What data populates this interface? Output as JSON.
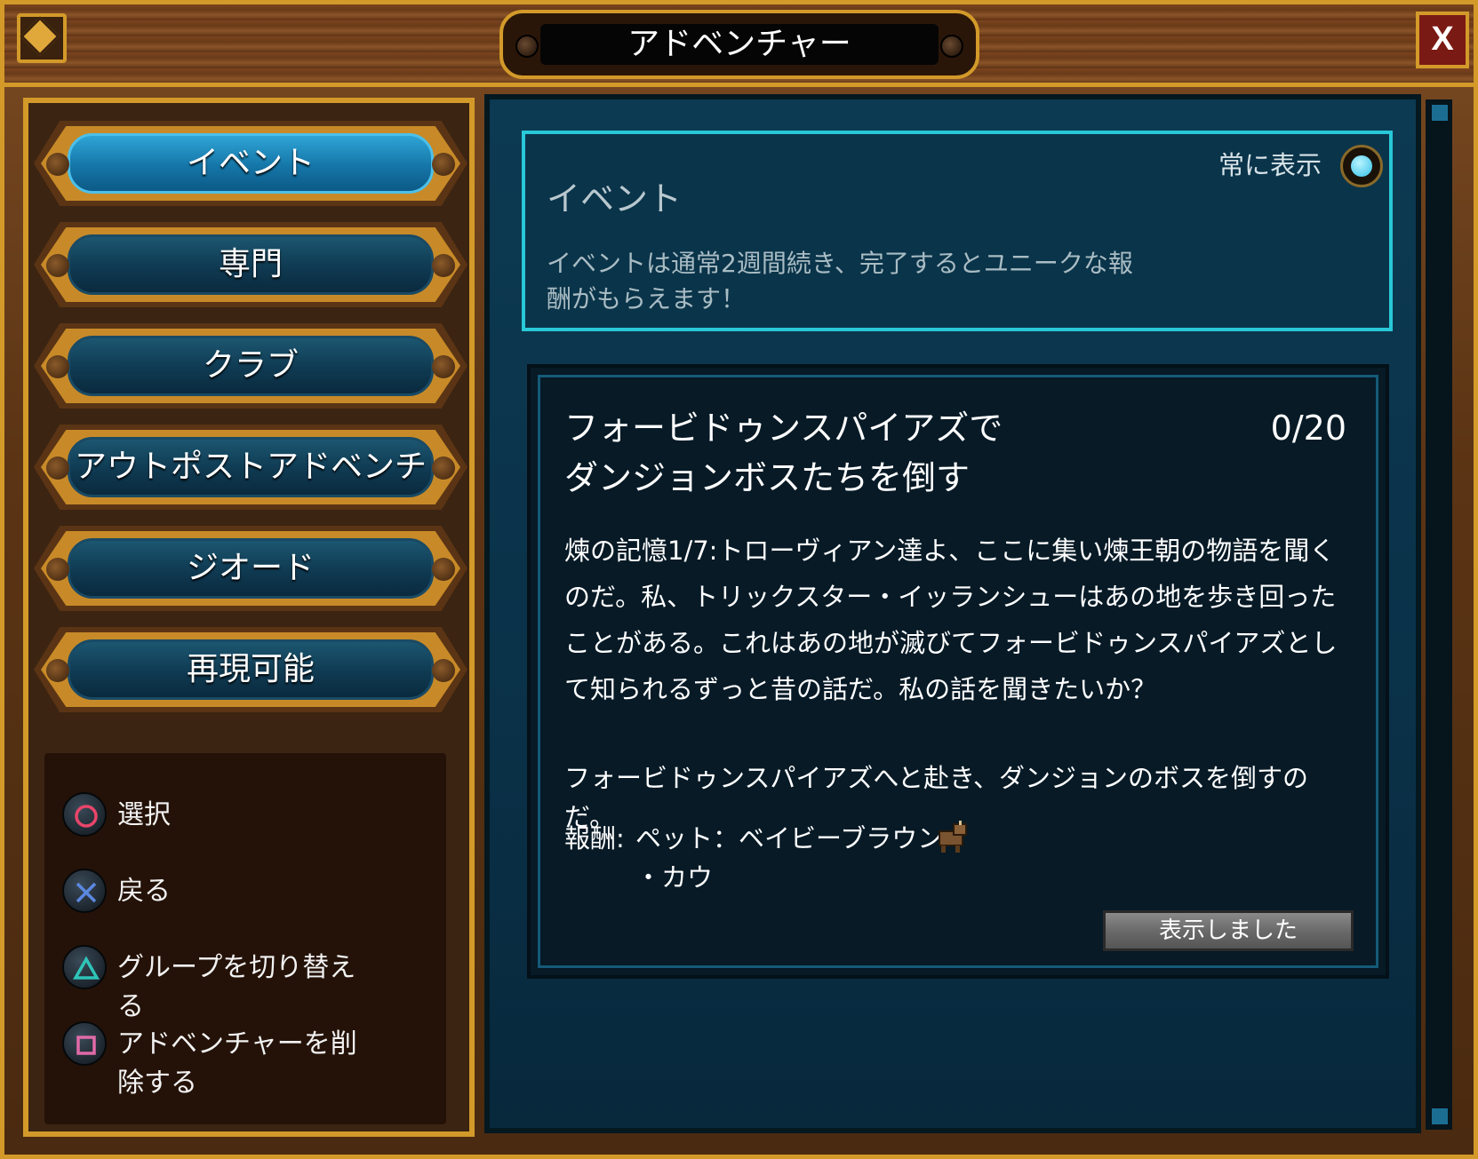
{
  "window": {
    "title": "アドベンチャー",
    "close_label": "X"
  },
  "nav": {
    "items": [
      {
        "label": "イベント",
        "active": true
      },
      {
        "label": "専門",
        "active": false
      },
      {
        "label": "クラブ",
        "active": false
      },
      {
        "label": "アウトポストアドベンチ",
        "active": false
      },
      {
        "label": "ジオード",
        "active": false
      },
      {
        "label": "再現可能",
        "active": false
      }
    ]
  },
  "controls": {
    "select": {
      "icon": "circle-button-icon",
      "label": "選択"
    },
    "back": {
      "icon": "cross-button-icon",
      "label": "戻る"
    },
    "switch_group": {
      "icon": "triangle-button-icon",
      "label": "グループを切り替える"
    },
    "delete": {
      "icon": "square-button-icon",
      "label": "アドベンチャーを削除する"
    }
  },
  "info": {
    "title": "イベント",
    "description": "イベントは通常2週間続き、完了するとユニークな報酬がもらえます！",
    "always_show_label": "常に表示",
    "always_show_on": true
  },
  "quest": {
    "title": "フォービドゥンスパイアズでダンジョンボスたちを倒す",
    "progress": "0/20",
    "progress_value": 0,
    "progress_max": 20,
    "story": "煉の記憶1/7:トローヴィアン達よ、ここに集い煉王朝の物語を聞くのだ。私、トリックスター・イッランシューはあの地を歩き回ったことがある。これはあの地が滅びてフォービドゥンスパイアズとして知られるずっと昔の話だ。私の話を聞きたいか？",
    "goal": "フォービドゥンスパイアズへと赴き、ダンジョンのボスを倒すのだ。",
    "reward_label": "報酬:",
    "reward_item": "ペット：ベイビーブラウン",
    "reward_sub": "・カウ",
    "reward_icon": "brown-cow-pet-icon",
    "seen_button": "表示しました"
  },
  "colors": {
    "gold_trim": "#d39a2a",
    "panel_blue": "#0c3a52",
    "accent_cyan": "#28c8d8",
    "active_tab": "#2fa4d6",
    "close_red": "#7a1a14"
  }
}
